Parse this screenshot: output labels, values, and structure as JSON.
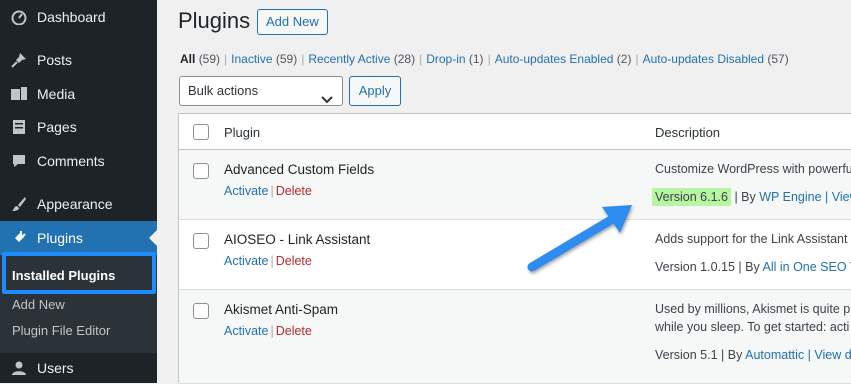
{
  "sidebar": {
    "items": [
      {
        "label": "Dashboard",
        "icon": "dashboard-icon"
      },
      {
        "label": "Posts",
        "icon": "pin-icon"
      },
      {
        "label": "Media",
        "icon": "media-icon"
      },
      {
        "label": "Pages",
        "icon": "page-icon"
      },
      {
        "label": "Comments",
        "icon": "comment-icon"
      },
      {
        "label": "Appearance",
        "icon": "brush-icon"
      },
      {
        "label": "Plugins",
        "icon": "plug-icon"
      },
      {
        "label": "Users",
        "icon": "user-icon"
      }
    ],
    "submenu": [
      "Installed Plugins",
      "Add New",
      "Plugin File Editor"
    ]
  },
  "header": {
    "title": "Plugins",
    "add_new": "Add New"
  },
  "filters": [
    {
      "label": "All",
      "count": "(59)"
    },
    {
      "label": "Inactive",
      "count": "(59)"
    },
    {
      "label": "Recently Active",
      "count": "(28)"
    },
    {
      "label": "Drop-in",
      "count": "(1)"
    },
    {
      "label": "Auto-updates Enabled",
      "count": "(2)"
    },
    {
      "label": "Auto-updates Disabled",
      "count": "(57)"
    }
  ],
  "bulk": {
    "select": "Bulk actions",
    "apply": "Apply"
  },
  "table": {
    "col_plugin": "Plugin",
    "col_description": "Description",
    "rows": [
      {
        "name": "Advanced Custom Fields",
        "activate": "Activate",
        "delete": "Delete",
        "desc1": "Customize WordPress with powerfu",
        "desc2": "",
        "version": "Version 6.1.6",
        "by": " | By ",
        "author": "WP Engine",
        "tail": " | View"
      },
      {
        "name": "AIOSEO - Link Assistant",
        "activate": "Activate",
        "delete": "Delete",
        "desc1": "Adds support for the Link Assistant",
        "desc2": "",
        "version": "Version 1.0.15",
        "by": " | By ",
        "author": "All in One SEO Te",
        "tail": ""
      },
      {
        "name": "Akismet Anti-Spam",
        "activate": "Activate",
        "delete": "Delete",
        "desc1": "Used by millions, Akismet is quite p",
        "desc2": "while you sleep. To get started: acti",
        "version": "Version 5.1",
        "by": " | By ",
        "author": "Automattic",
        "tail": " | View d"
      }
    ]
  },
  "colors": {
    "accent": "#2271b1",
    "sidebar_bg": "#1d2327",
    "highlight": "#1e8cff",
    "version_highlight": "#b8f5a1"
  }
}
